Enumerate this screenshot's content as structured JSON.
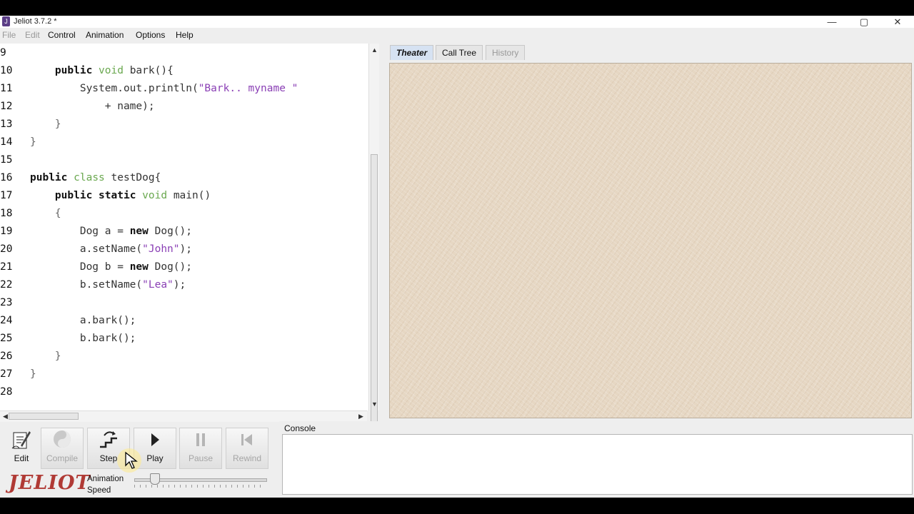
{
  "window": {
    "title": "Jeliot 3.7.2 *",
    "minimize": "—",
    "maximize": "▢",
    "close": "✕"
  },
  "menu": [
    {
      "label": "File",
      "enabled": false
    },
    {
      "label": "Edit",
      "enabled": false
    },
    {
      "label": "Control",
      "enabled": true
    },
    {
      "label": "Animation",
      "enabled": true
    },
    {
      "label": "Options",
      "enabled": true
    },
    {
      "label": "Help",
      "enabled": true
    }
  ],
  "editor": {
    "lines": [
      {
        "n": "9",
        "segs": []
      },
      {
        "n": "10",
        "segs": [
          [
            "t",
            "    "
          ],
          [
            "kw",
            "public"
          ],
          [
            "t",
            " "
          ],
          [
            "mod",
            "void"
          ],
          [
            "t",
            " bark(){"
          ]
        ]
      },
      {
        "n": "11",
        "segs": [
          [
            "t",
            "        System.out.println("
          ],
          [
            "str",
            "\"Bark.. myname \""
          ]
        ]
      },
      {
        "n": "12",
        "segs": [
          [
            "t",
            "            + name);"
          ]
        ]
      },
      {
        "n": "13",
        "segs": [
          [
            "sym",
            "    }"
          ]
        ]
      },
      {
        "n": "14",
        "segs": [
          [
            "sym",
            "}"
          ]
        ]
      },
      {
        "n": "15",
        "segs": []
      },
      {
        "n": "16",
        "segs": [
          [
            "kw",
            "public"
          ],
          [
            "t",
            " "
          ],
          [
            "mod",
            "class"
          ],
          [
            "t",
            " testDog{"
          ]
        ]
      },
      {
        "n": "17",
        "segs": [
          [
            "t",
            "    "
          ],
          [
            "kw",
            "public"
          ],
          [
            "t",
            " "
          ],
          [
            "kw",
            "static"
          ],
          [
            "t",
            " "
          ],
          [
            "mod",
            "void"
          ],
          [
            "t",
            " main()"
          ]
        ]
      },
      {
        "n": "18",
        "segs": [
          [
            "sym",
            "    {"
          ]
        ]
      },
      {
        "n": "19",
        "segs": [
          [
            "t",
            "        Dog a = "
          ],
          [
            "kw",
            "new"
          ],
          [
            "t",
            " Dog();"
          ]
        ]
      },
      {
        "n": "20",
        "segs": [
          [
            "t",
            "        a.setName("
          ],
          [
            "str",
            "\"John\""
          ],
          [
            "t",
            ");"
          ]
        ]
      },
      {
        "n": "21",
        "segs": [
          [
            "t",
            "        Dog b = "
          ],
          [
            "kw",
            "new"
          ],
          [
            "t",
            " Dog();"
          ]
        ]
      },
      {
        "n": "22",
        "segs": [
          [
            "t",
            "        b.setName("
          ],
          [
            "str",
            "\"Lea\""
          ],
          [
            "t",
            ");"
          ]
        ]
      },
      {
        "n": "23",
        "segs": []
      },
      {
        "n": "24",
        "segs": [
          [
            "t",
            "        a.bark();"
          ]
        ]
      },
      {
        "n": "25",
        "segs": [
          [
            "t",
            "        b.bark();"
          ]
        ]
      },
      {
        "n": "26",
        "segs": [
          [
            "sym",
            "    }"
          ]
        ]
      },
      {
        "n": "27",
        "segs": [
          [
            "sym",
            "}"
          ]
        ]
      },
      {
        "n": "28",
        "segs": []
      }
    ]
  },
  "tabs": [
    {
      "label": "Theater",
      "state": "active"
    },
    {
      "label": "Call Tree",
      "state": "normal"
    },
    {
      "label": "History",
      "state": "disabled"
    }
  ],
  "controls": {
    "edit": {
      "label": "Edit",
      "icon": "edit-icon",
      "enabled": true
    },
    "compile": {
      "label": "Compile",
      "icon": "compile-icon",
      "enabled": false
    },
    "step": {
      "label": "Step",
      "icon": "step-icon",
      "enabled": true
    },
    "play": {
      "label": "Play",
      "icon": "play-icon",
      "enabled": true
    },
    "pause": {
      "label": "Pause",
      "icon": "pause-icon",
      "enabled": false
    },
    "rewind": {
      "label": "Rewind",
      "icon": "rewind-icon",
      "enabled": false
    }
  },
  "logo": "JELIOT",
  "speed_label_1": "Animation",
  "speed_label_2": "Speed",
  "speed_value": 0.15,
  "console": {
    "label": "Console",
    "text": ""
  },
  "colors": {
    "keyword": "#111111",
    "modifier": "#6aa84f",
    "string": "#8a3fb5",
    "logo": "#b03a35",
    "theater_bg": "#e6d7c3"
  }
}
